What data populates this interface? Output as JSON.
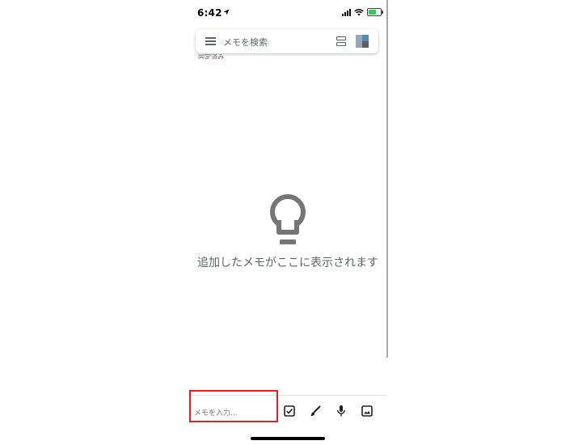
{
  "status_bar": {
    "time": "6:42",
    "icons": [
      "location-arrow-icon",
      "signal-icon",
      "wifi-icon",
      "battery-charging-icon"
    ]
  },
  "search": {
    "placeholder": "メモを検索",
    "menu_icon": "menu-icon",
    "layout_icon": "list-view-icon",
    "avatar_icon": "account-avatar"
  },
  "top_label_cut": "固定済み",
  "empty_state": {
    "icon": "lightbulb-icon",
    "message": "追加したメモがここに表示されます"
  },
  "bottom_bar": {
    "note_placeholder": "メモを入力...",
    "tools": [
      "checkbox-icon",
      "brush-icon",
      "microphone-icon",
      "image-icon"
    ],
    "highlight_color": "#e02020"
  },
  "colors": {
    "icon_gray": "#5f6368",
    "empty_text": "#5f6368",
    "battery_green": "#34c759"
  }
}
